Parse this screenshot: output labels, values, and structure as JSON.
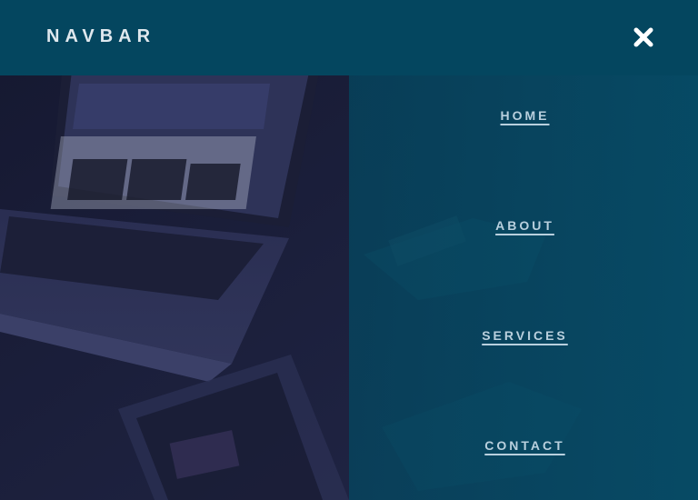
{
  "header": {
    "brand": "NAVBAR",
    "close_icon": "close-x-icon"
  },
  "menu": {
    "items": [
      {
        "label": "HOME"
      },
      {
        "label": "ABOUT"
      },
      {
        "label": "SERVICES"
      },
      {
        "label": "CONTACT"
      }
    ]
  },
  "colors": {
    "header_bg": "#04465f",
    "panel_bg": "#054e68",
    "link_color": "#b9d0de",
    "backdrop": "#1a1d3a"
  }
}
